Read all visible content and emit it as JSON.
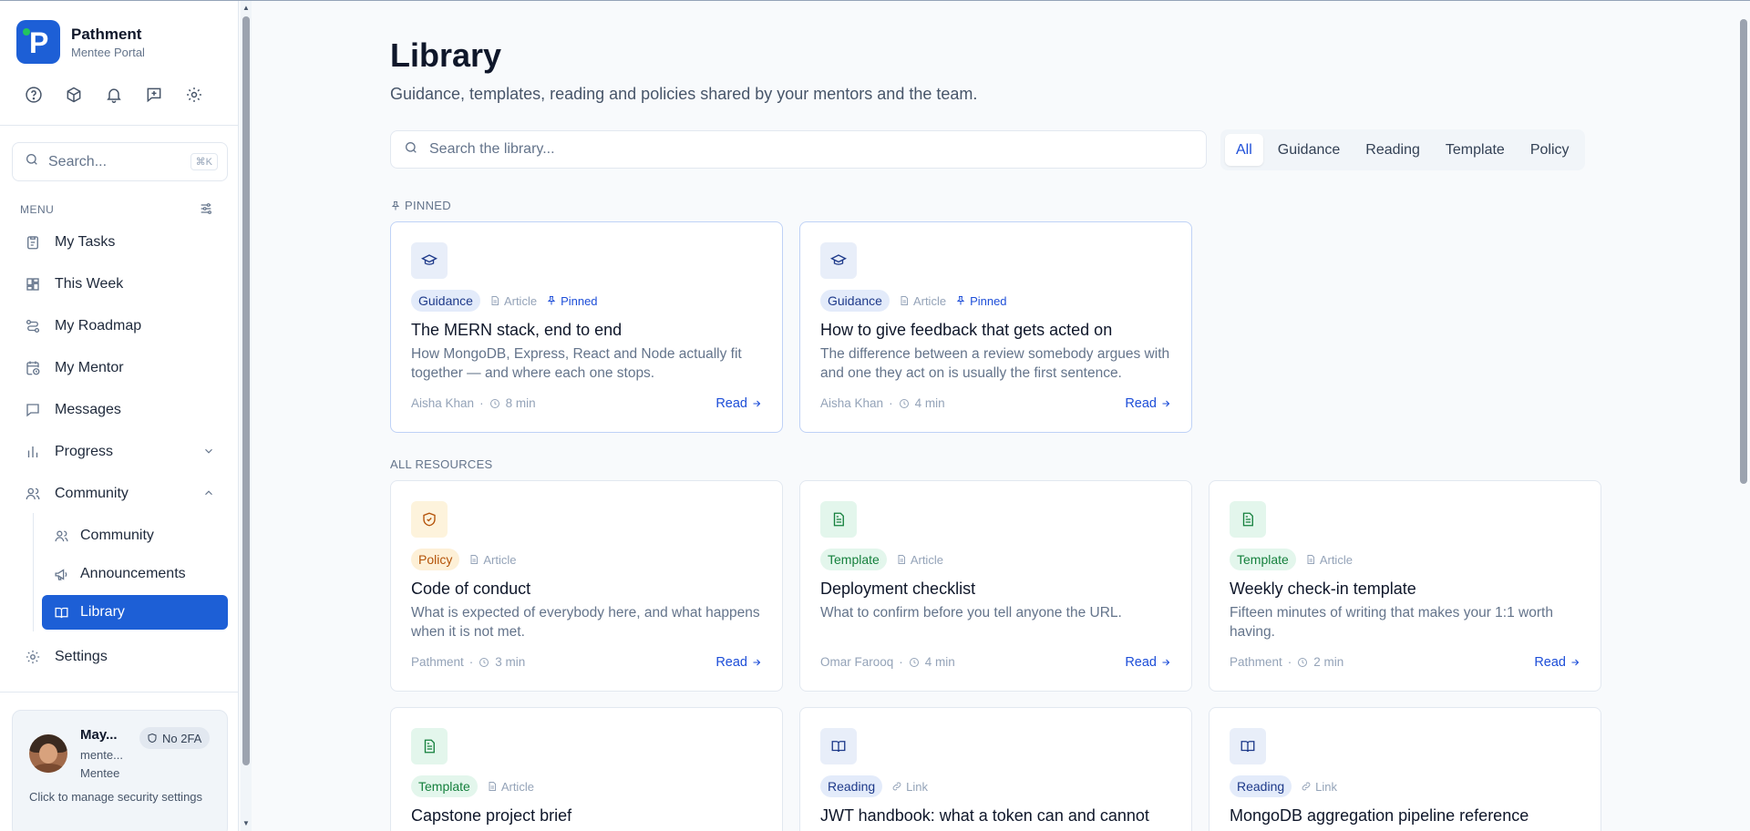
{
  "brand": {
    "name": "Pathment",
    "subtitle": "Mentee Portal",
    "logo_letter": "P",
    "accent": "#1d5fd6"
  },
  "sidebar": {
    "search_placeholder": "Search...",
    "search_shortcut": "⌘K",
    "menu_label": "MENU",
    "items": [
      {
        "label": "My Tasks"
      },
      {
        "label": "This Week"
      },
      {
        "label": "My Roadmap"
      },
      {
        "label": "My Mentor"
      },
      {
        "label": "Messages"
      },
      {
        "label": "Progress"
      },
      {
        "label": "Community"
      }
    ],
    "sub_items": [
      {
        "label": "Community"
      },
      {
        "label": "Announcements"
      },
      {
        "label": "Library"
      }
    ],
    "settings_label": "Settings"
  },
  "user": {
    "name": "May...",
    "email": "mente...",
    "role": "Mentee",
    "badge": "No 2FA",
    "hint": "Click to manage security settings"
  },
  "main": {
    "title": "Library",
    "subtitle": "Guidance, templates, reading and policies shared by your mentors and the team.",
    "search_placeholder": "Search the library...",
    "filters": [
      "All",
      "Guidance",
      "Reading",
      "Template",
      "Policy"
    ],
    "pinned_label": "PINNED",
    "all_label": "ALL RESOURCES",
    "read_label": "Read"
  },
  "pinned_cards": [
    {
      "category": "Guidance",
      "kind": "Article",
      "pin_label": "Pinned",
      "title": "The MERN stack, end to end",
      "description": "How MongoDB, Express, React and Node actually fit together — and where each one stops.",
      "author": "Aisha Khan",
      "duration": "8 min"
    },
    {
      "category": "Guidance",
      "kind": "Article",
      "pin_label": "Pinned",
      "title": "How to give feedback that gets acted on",
      "description": "The difference between a review somebody argues with and one they act on is usually the first sentence.",
      "author": "Aisha Khan",
      "duration": "4 min"
    }
  ],
  "resource_cards": [
    {
      "category": "Policy",
      "kind": "Article",
      "title": "Code of conduct",
      "description": "What is expected of everybody here, and what happens when it is not met.",
      "author": "Pathment",
      "duration": "3 min"
    },
    {
      "category": "Template",
      "kind": "Article",
      "title": "Deployment checklist",
      "description": "What to confirm before you tell anyone the URL.",
      "author": "Omar Farooq",
      "duration": "4 min"
    },
    {
      "category": "Template",
      "kind": "Article",
      "title": "Weekly check-in template",
      "description": "Fifteen minutes of writing that makes your 1:1 worth having.",
      "author": "Pathment",
      "duration": "2 min"
    },
    {
      "category": "Template",
      "kind": "Article",
      "title": "Capstone project brief"
    },
    {
      "category": "Reading",
      "kind": "Link",
      "title": "JWT handbook: what a token can and cannot"
    },
    {
      "category": "Reading",
      "kind": "Link",
      "title": "MongoDB aggregation pipeline reference"
    }
  ]
}
